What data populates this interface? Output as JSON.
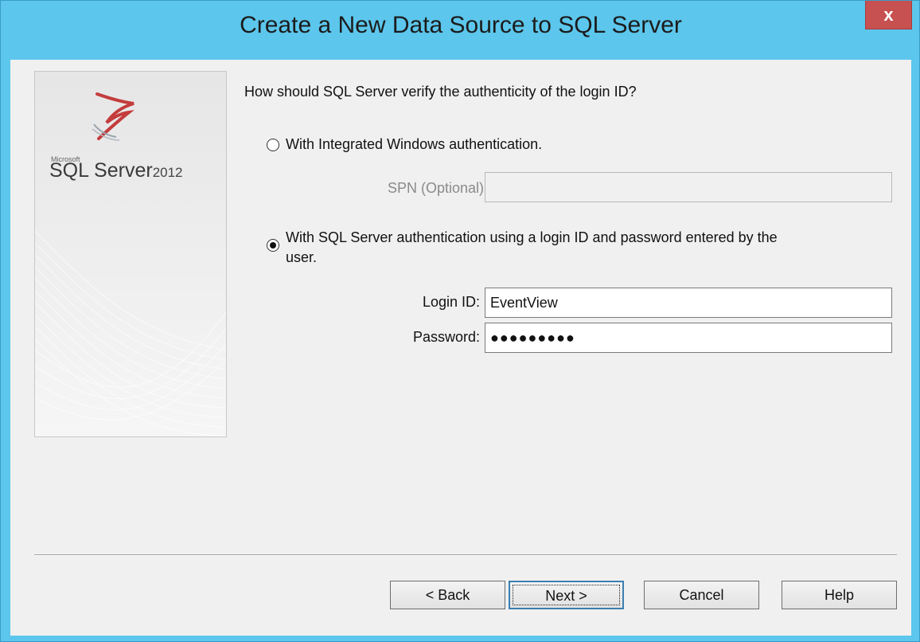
{
  "window": {
    "title": "Create a New Data Source to SQL Server",
    "close_label": "x"
  },
  "banner": {
    "brand_small": "Microsoft",
    "product": "SQL Server",
    "version": "2012"
  },
  "auth": {
    "question": "How should SQL Server verify the authenticity of the login ID?",
    "integrated_label": "With Integrated Windows authentication.",
    "integrated_selected": false,
    "spn_label": "SPN (Optional):",
    "spn_value": "",
    "sql_label_line1": "With SQL Server authentication using a login ID and password entered by the",
    "sql_label_line2": "user.",
    "sql_selected": true,
    "login_label": "Login ID:",
    "login_value": "EventView",
    "password_label": "Password:",
    "password_mask": "●●●●●●●●●"
  },
  "buttons": {
    "back": "< Back",
    "next": "Next >",
    "cancel": "Cancel",
    "help": "Help"
  },
  "colors": {
    "title_bar": "#5cc6ec",
    "close_button": "#c75050",
    "client_bg": "#f0f0f0"
  }
}
